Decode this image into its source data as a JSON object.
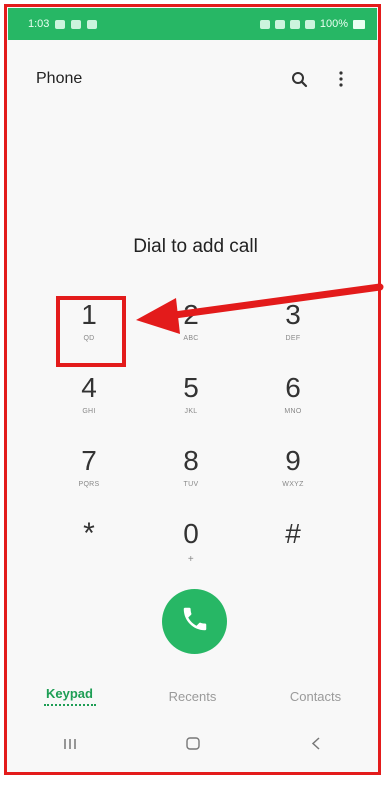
{
  "status_bar": {
    "time": "1:03",
    "battery": "100%"
  },
  "app_bar": {
    "title": "Phone"
  },
  "dialer": {
    "prompt": "Dial to add call",
    "keys": [
      {
        "digit": "1",
        "letters": "QD"
      },
      {
        "digit": "2",
        "letters": "ABC"
      },
      {
        "digit": "3",
        "letters": "DEF"
      },
      {
        "digit": "4",
        "letters": "GHI"
      },
      {
        "digit": "5",
        "letters": "JKL"
      },
      {
        "digit": "6",
        "letters": "MNO"
      },
      {
        "digit": "7",
        "letters": "PQRS"
      },
      {
        "digit": "8",
        "letters": "TUV"
      },
      {
        "digit": "9",
        "letters": "WXYZ"
      },
      {
        "digit": "*",
        "letters": ""
      },
      {
        "digit": "0",
        "letters": "+"
      },
      {
        "digit": "#",
        "letters": ""
      }
    ]
  },
  "tabs": [
    {
      "label": "Keypad",
      "active": true
    },
    {
      "label": "Recents",
      "active": false
    },
    {
      "label": "Contacts",
      "active": false
    }
  ],
  "colors": {
    "accent": "#27b765",
    "annotation": "#e31b1b"
  },
  "icons": {
    "search": "search-icon",
    "more": "more-vert-icon",
    "call": "phone-icon",
    "recent_apps": "recent-apps-icon",
    "home": "home-icon",
    "back": "back-icon"
  }
}
